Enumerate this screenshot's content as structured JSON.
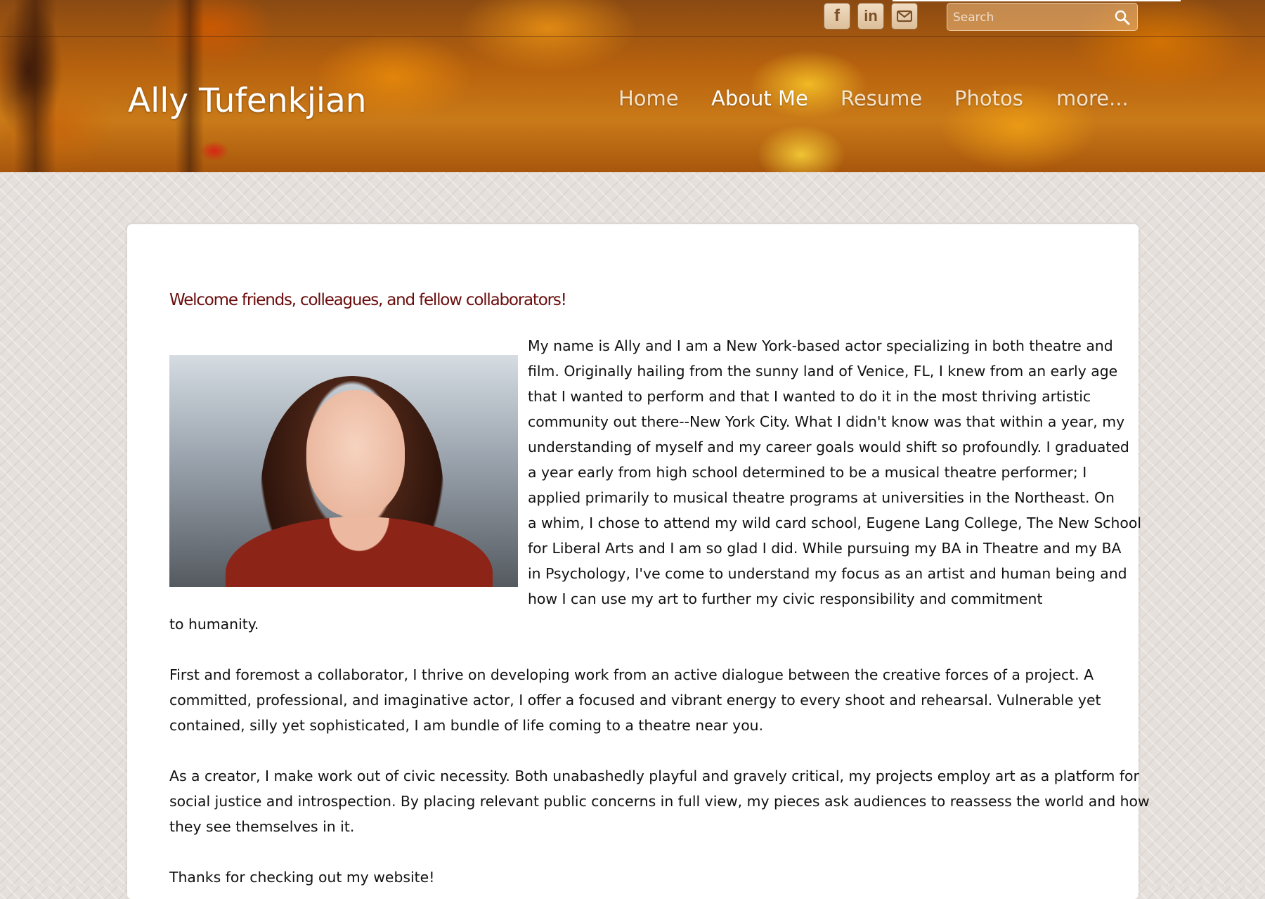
{
  "header": {
    "site_title": "Ally Tufenkjian",
    "nav": [
      "Home",
      "About Me",
      "Resume",
      "Photos",
      "more..."
    ],
    "active_nav": "About Me",
    "social": {
      "facebook": "f",
      "linkedin": "in"
    },
    "search": {
      "placeholder": "Search",
      "value": ""
    }
  },
  "content": {
    "welcome": "Welcome friends, colleagues, and fellow collaborators!",
    "intro_lines": [
      "My name is Ally and I am a New York-based actor specializing in both theatre and",
      "film.  Originally hailing from the sunny land of Venice, FL, I knew from an early age",
      "that I wanted to perform and that I wanted to do it in the most thriving artistic",
      "community out there--New York City.  What I didn't know was that within a year, my",
      "understanding of myself and my career goals would shift so profoundly.  I graduated",
      "a year early from high school determined to be a musical theatre performer; I",
      "applied primarily to musical theatre programs at universities in the Northeast.  On",
      "a whim, I chose to attend my wild card school, Eugene Lang College, The New School",
      "for Liberal Arts and I am so glad I did.  While pursuing my BA in Theatre and my BA",
      "in Psychology, I've come to understand my focus as an artist and human being and",
      "how I can use my art to further my civic responsibility and commitment"
    ],
    "intro_tail": "to humanity.",
    "p2_lines": [
      "First and foremost a collaborator, I thrive on developing work from an active dialogue between the creative forces of a project.  A",
      "committed, professional, and imaginative actor, I offer a focused and vibrant energy to every shoot and rehearsal.  Vulnerable yet",
      "contained, silly yet sophisticated, I am bundle of life coming to a theatre near you."
    ],
    "p3_lines": [
      "As a creator, I make work out of civic necessity.  Both unabashedly playful and gravely critical, my projects employ art as a platform for",
      "social justice and introspection.  By placing relevant public concerns in full view, my pieces ask audiences to reassess the world and how",
      "they see themselves in it."
    ],
    "closing": "Thanks for checking out my website!"
  },
  "colors": {
    "welcome_heading": "#6b0d0d",
    "card_background": "#ffffff",
    "page_background": "#e6e0dc",
    "header_autumn_orange": "#c97a18"
  }
}
